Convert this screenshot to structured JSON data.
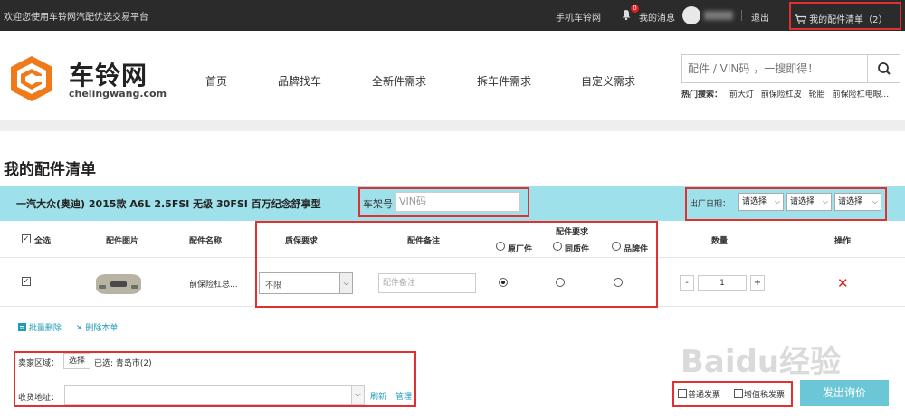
{
  "topbar": {
    "welcome": "欢迎您使用车铃网汽配优选交易平台",
    "mobile": "手机车铃网",
    "notification_count": "0",
    "messages": "我的消息",
    "logout": "退出",
    "cart": "我的配件清单（2）"
  },
  "header": {
    "logo_name": "车铃网",
    "logo_sub": "chelingwang.com",
    "nav": [
      "首页",
      "品牌找车",
      "全新件需求",
      "拆车件需求",
      "自定义需求"
    ],
    "search_placeholder": "配件 / VIN码 ，一搜即得！",
    "hot_label": "热门搜索：",
    "hot_items": [
      "前大灯",
      "前保险杠皮",
      "轮胎",
      "前保险杠电眼..."
    ]
  },
  "page_title": "我的配件清单",
  "car": {
    "name": "一汽大众(奥迪) 2015款 A6L 2.5FSI 无级 30FSI 百万纪念舒享型",
    "vin_label": "车架号",
    "vin_placeholder": "VIN码",
    "date_label": "出厂日期：",
    "date_selects": [
      "请选择",
      "请选择",
      "请选择"
    ]
  },
  "table": {
    "select_all": "全选",
    "col_image": "配件图片",
    "col_name": "配件名称",
    "col_quality": "质保要求",
    "col_note": "配件备注",
    "col_req": "配件要求",
    "req_options": [
      "原厂件",
      "同质件",
      "品牌件"
    ],
    "col_qty": "数量",
    "col_op": "操作",
    "row": {
      "name": "前保险杠总...",
      "quality": "不限",
      "note_placeholder": "配件备注",
      "req_selected": "原厂件",
      "qty": "1",
      "minus": "-",
      "plus": "+",
      "checked": true
    }
  },
  "actions": {
    "batch_delete": "批量删除",
    "delete_list": "删除本单"
  },
  "footer": {
    "seller_label": "卖家区域：",
    "choose": "选择",
    "selected": "已选: 青岛市(2)",
    "address_label": "收货地址：",
    "refresh": "刷新",
    "manage": "管理",
    "invoice_normal": "普通发票",
    "invoice_vat": "增值税发票",
    "submit": "发出询价"
  },
  "watermark": "Baidu经验",
  "colors": {
    "accent": "#1f9bb8",
    "car_bar": "#9fe1ea",
    "highlight": "#e03030",
    "logo": "#f07a1a",
    "submit": "#6bc7d6"
  }
}
